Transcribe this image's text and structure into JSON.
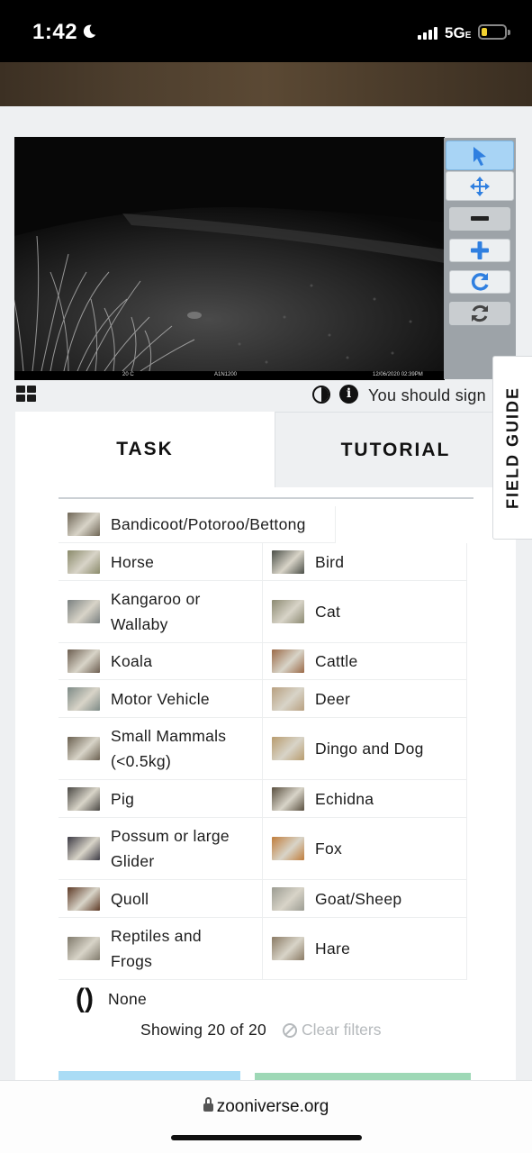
{
  "status_bar": {
    "time": "1:42",
    "network": "5G",
    "network_suffix": "E",
    "battery_level": 0.2
  },
  "viewer": {
    "camera_overlay": {
      "temperature": "20 C",
      "camera_id": "A1N1200",
      "timestamp": "12/06/2020 02:39PM"
    },
    "tools": [
      {
        "name": "pointer-tool",
        "icon": "cursor-icon",
        "active": true
      },
      {
        "name": "move-tool",
        "icon": "move-arrows-icon",
        "active": false
      },
      {
        "name": "zoom-out-tool",
        "icon": "minus-icon",
        "active": false
      },
      {
        "name": "zoom-in-tool",
        "icon": "plus-icon",
        "active": false
      },
      {
        "name": "rotate-tool",
        "icon": "rotate-icon",
        "active": false
      },
      {
        "name": "reset-tool",
        "icon": "refresh-icon",
        "active": false,
        "disabled": true
      }
    ],
    "sign_in_notice": "You should sign"
  },
  "task_panel": {
    "tabs": {
      "task": "TASK",
      "tutorial": "TUTORIAL"
    },
    "field_guide": "FIELD GUIDE",
    "choices": [
      {
        "label": "Bandicoot/Potoroo/Bettong",
        "thumb": "#6f6656"
      },
      {
        "label": "Horse",
        "thumb": "#8a8a6a"
      },
      {
        "label": "Bird",
        "thumb": "#4b4f48"
      },
      {
        "label": "Kangaroo or Wallaby",
        "thumb": "#7a8080"
      },
      {
        "label": "Cat",
        "thumb": "#8c8a72"
      },
      {
        "label": "Koala",
        "thumb": "#6c5e50"
      },
      {
        "label": "Cattle",
        "thumb": "#9b6a48"
      },
      {
        "label": "Motor Vehicle",
        "thumb": "#7d8a86"
      },
      {
        "label": "Deer",
        "thumb": "#b8a080"
      },
      {
        "label": "Small Mammals (<0.5kg)",
        "thumb": "#6a6050"
      },
      {
        "label": "Dingo and Dog",
        "thumb": "#b89c6e"
      },
      {
        "label": "Pig",
        "thumb": "#4a4844"
      },
      {
        "label": "Echidna",
        "thumb": "#5a5040"
      },
      {
        "label": "Possum or large Glider",
        "thumb": "#3c3a44"
      },
      {
        "label": "Fox",
        "thumb": "#c07d3c"
      },
      {
        "label": "Quoll",
        "thumb": "#5e3a26"
      },
      {
        "label": "Goat/Sheep",
        "thumb": "#9c9c92"
      },
      {
        "label": "Reptiles and Frogs",
        "thumb": "#807a6c"
      },
      {
        "label": "Hare",
        "thumb": "#8a7a64"
      },
      {
        "label": "None",
        "glyph": "()"
      }
    ],
    "showing": "Showing 20 of 20",
    "clear_filters": "Clear filters"
  },
  "browser": {
    "url": "zooniverse.org"
  }
}
